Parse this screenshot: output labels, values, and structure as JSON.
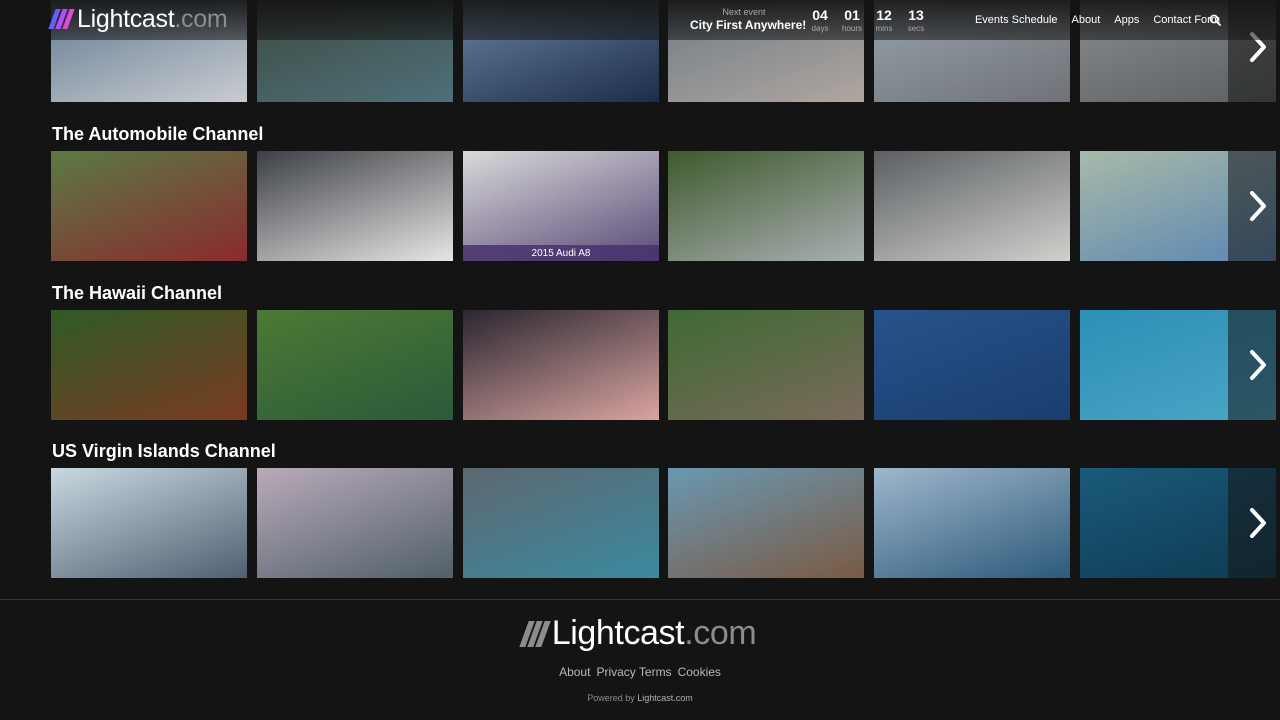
{
  "header": {
    "logo_word": "Lightcast",
    "logo_dot": ".com",
    "next_event_label": "Next event",
    "next_event_name": "City First Anywhere!",
    "countdown": [
      {
        "value": "04",
        "unit": "days"
      },
      {
        "value": "01",
        "unit": "hours"
      },
      {
        "value": "12",
        "unit": "mins"
      },
      {
        "value": "13",
        "unit": "secs"
      }
    ],
    "nav": [
      "Events Schedule",
      "About",
      "Apps",
      "Contact Form"
    ],
    "search_icon": "search-icon"
  },
  "rows": [
    {
      "title": "",
      "thumbs": [
        {
          "top": "#5f7790",
          "bottom": "#c9ccd0"
        },
        {
          "top": "#3c4a3f",
          "bottom": "#4f6f7a"
        },
        {
          "top": "#6d86a3",
          "bottom": "#1b2d4a"
        },
        {
          "top": "#6b7a84",
          "bottom": "#b0a6a0"
        },
        {
          "top": "#9aa4ad",
          "bottom": "#6f7378"
        },
        {
          "top": "#8c8e90",
          "bottom": "#5a5f63"
        }
      ]
    },
    {
      "title": "The Automobile Channel",
      "thumbs": [
        {
          "top": "#5b7a45",
          "bottom": "#8a2a2e"
        },
        {
          "top": "#3c3f44",
          "bottom": "#e6e6e6"
        },
        {
          "top": "#d9d9d9",
          "bottom": "#5a4a78",
          "caption": "2015 Audi A8"
        },
        {
          "top": "#3f5a2c",
          "bottom": "#a9aeb2"
        },
        {
          "top": "#5b5f63",
          "bottom": "#d0d0cc"
        },
        {
          "top": "#a7b9a8",
          "bottom": "#5c87b3"
        }
      ]
    },
    {
      "title": "The Hawaii Channel",
      "thumbs": [
        {
          "top": "#2f5a26",
          "bottom": "#7a3a22"
        },
        {
          "top": "#4c7a34",
          "bottom": "#2a5a3a"
        },
        {
          "top": "#2a2630",
          "bottom": "#d9a4a0"
        },
        {
          "top": "#3e6a34",
          "bottom": "#7a6a5a"
        },
        {
          "top": "#27538a",
          "bottom": "#1a3d6e"
        },
        {
          "top": "#2c8fb5",
          "bottom": "#4ba6c6"
        }
      ]
    },
    {
      "title": "US Virgin Islands Channel",
      "thumbs": [
        {
          "top": "#c9d8e0",
          "bottom": "#506072"
        },
        {
          "top": "#b9aab9",
          "bottom": "#50606a"
        },
        {
          "top": "#5d6770",
          "bottom": "#3b8aa0"
        },
        {
          "top": "#6a98b2",
          "bottom": "#7a5a44"
        },
        {
          "top": "#9fb6cc",
          "bottom": "#2c5a7a"
        },
        {
          "top": "#1a5a7a",
          "bottom": "#0e3a52"
        }
      ]
    }
  ],
  "footer": {
    "logo_word": "Lightcast",
    "logo_dot": ".com",
    "links": [
      "About",
      "Privacy Terms",
      "Cookies"
    ],
    "powered_prefix": "Powered by ",
    "powered_link": "Lightcast.com"
  }
}
